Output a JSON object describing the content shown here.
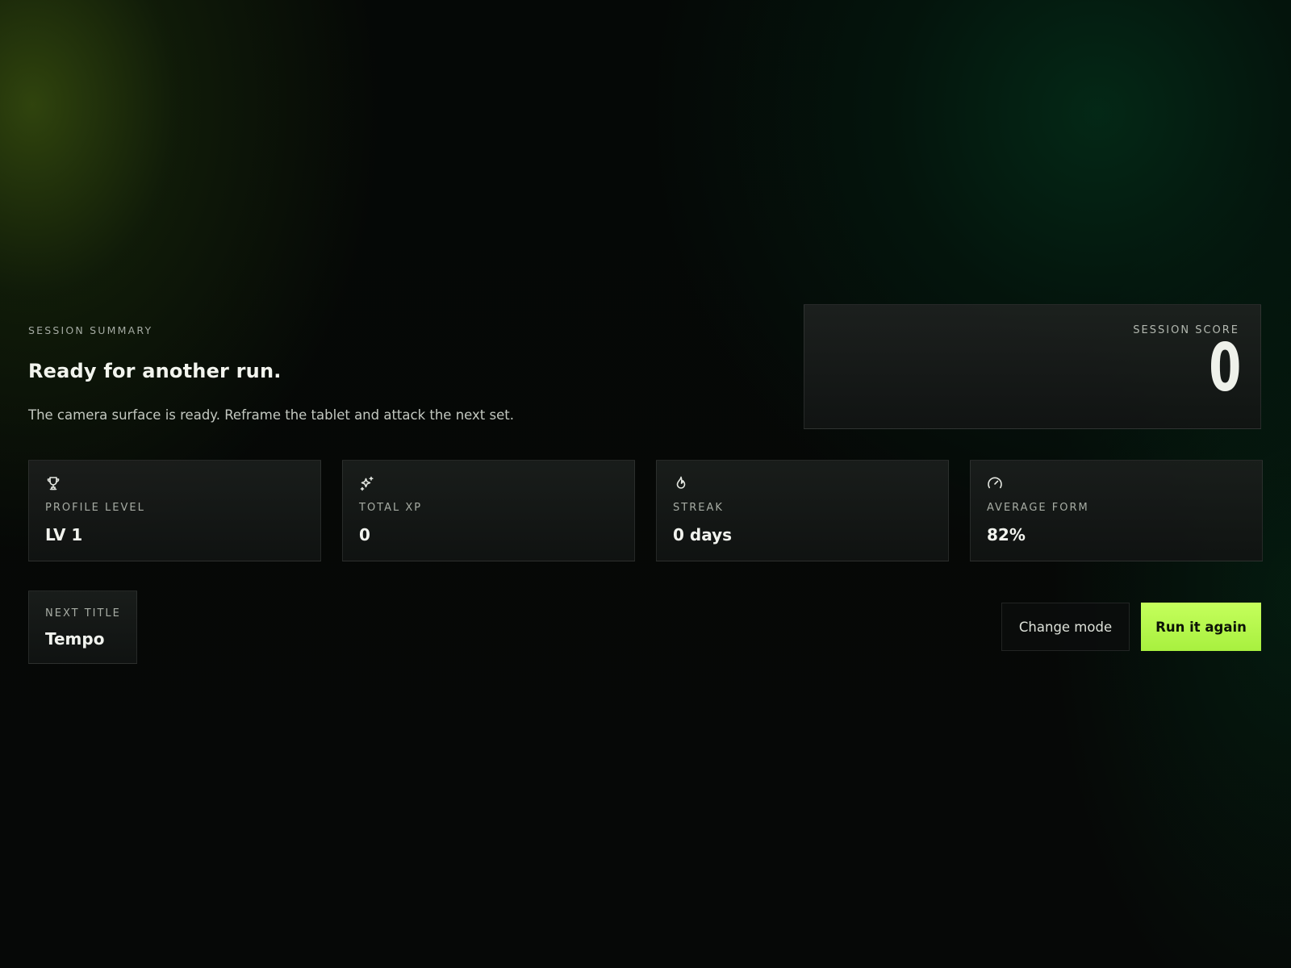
{
  "summary": {
    "eyebrow": "SESSION SUMMARY",
    "headline": "Ready for another run.",
    "subcopy": "The camera surface is ready. Reframe the tablet and attack the next set."
  },
  "score": {
    "label": "SESSION SCORE",
    "value": "0"
  },
  "stats": [
    {
      "icon": "trophy-icon",
      "label": "PROFILE LEVEL",
      "value": "LV 1"
    },
    {
      "icon": "sparkles-icon",
      "label": "TOTAL XP",
      "value": "0"
    },
    {
      "icon": "flame-icon",
      "label": "STREAK",
      "value": "0 days"
    },
    {
      "icon": "gauge-icon",
      "label": "AVERAGE FORM",
      "value": "82%"
    }
  ],
  "next_title": {
    "label": "NEXT TITLE",
    "value": "Tempo"
  },
  "actions": {
    "change_mode_label": "Change mode",
    "run_again_label": "Run it again"
  },
  "colors": {
    "accent": "#b6f84a",
    "background": "#060807",
    "card": "#181b1a"
  }
}
